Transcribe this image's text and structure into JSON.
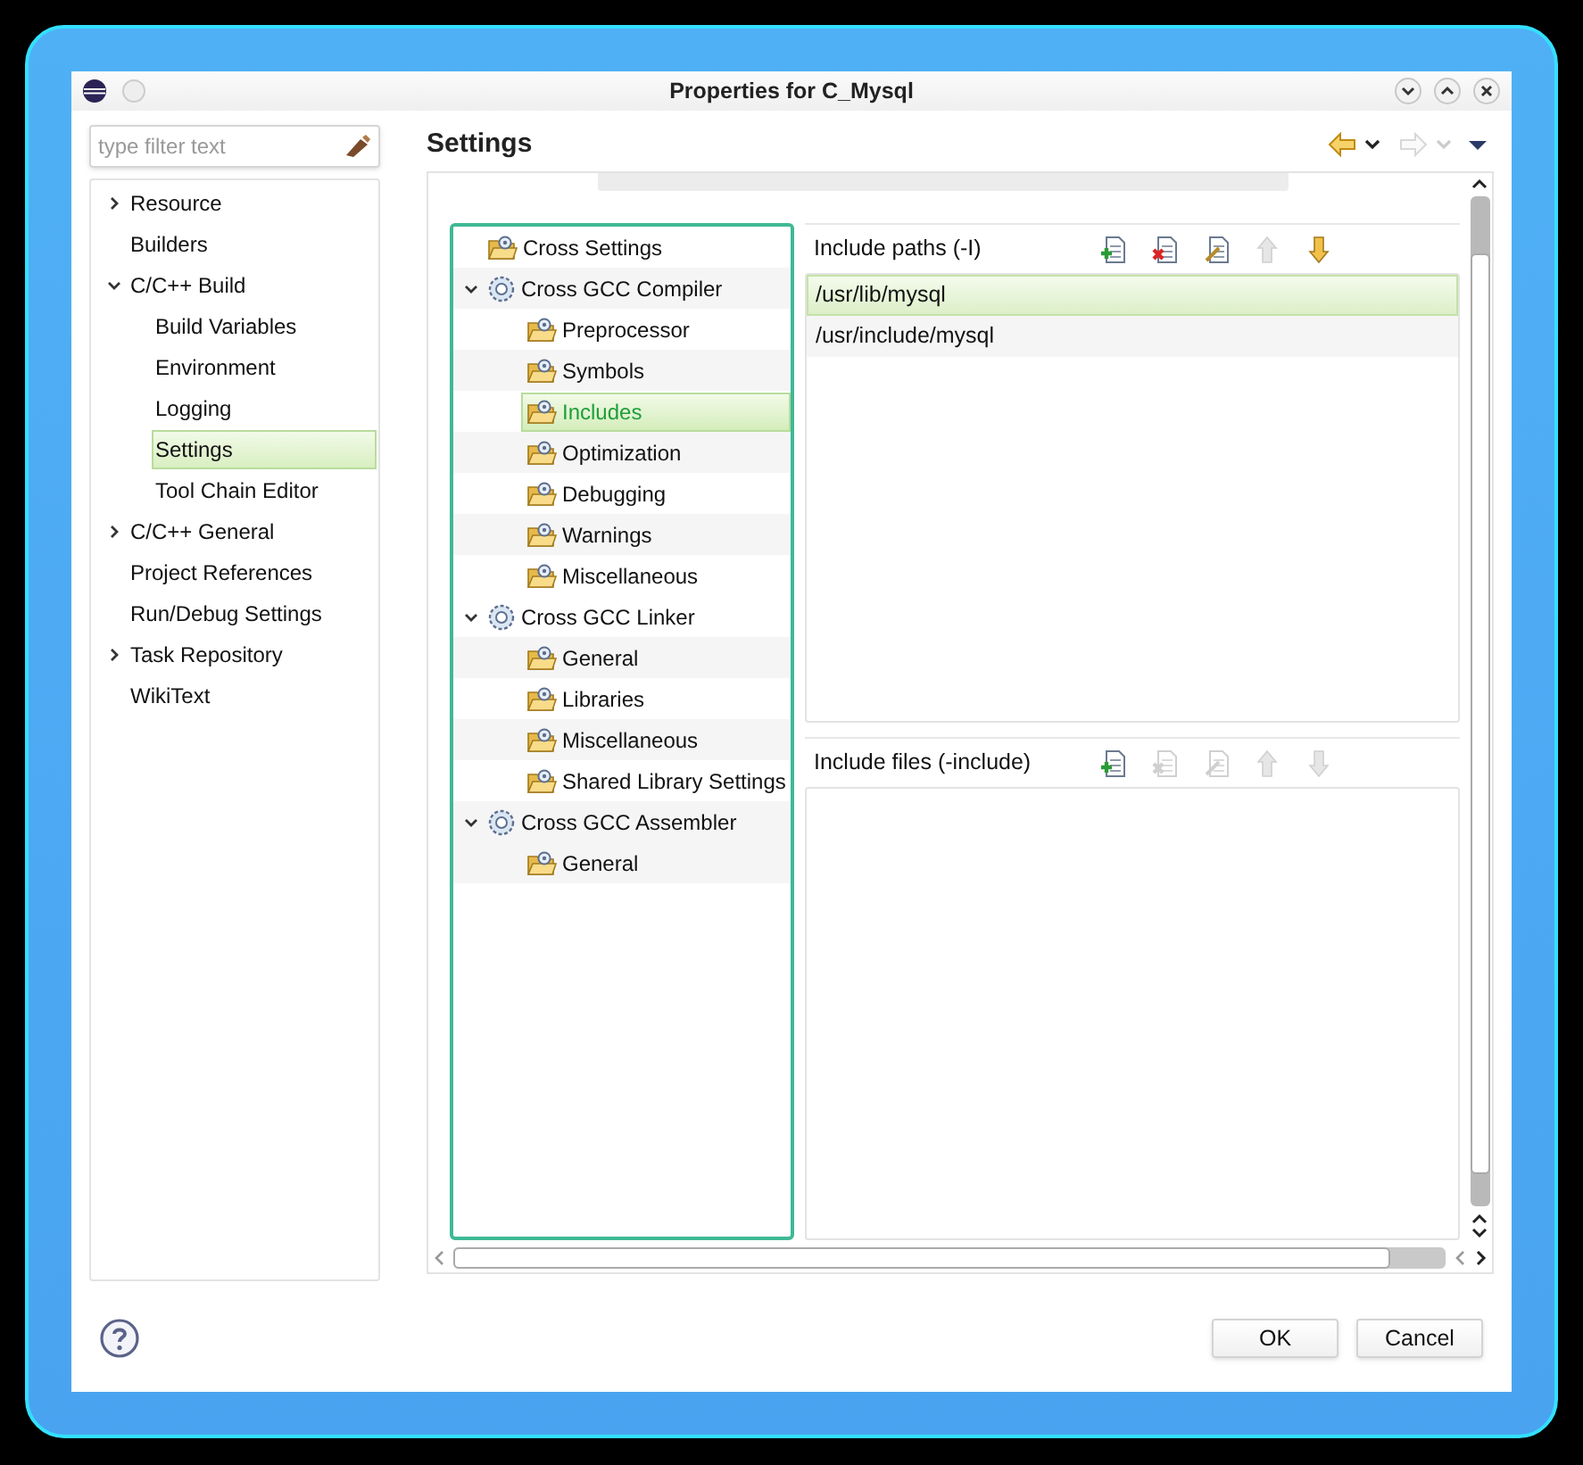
{
  "window": {
    "title": "Properties for C_Mysql"
  },
  "filter": {
    "placeholder": "type filter text"
  },
  "nav": [
    {
      "label": "Resource",
      "expanded": false,
      "selected": false
    },
    {
      "label": "Builders",
      "selected": false
    },
    {
      "label": "C/C++ Build",
      "expanded": true,
      "selected": false,
      "children": [
        {
          "label": "Build Variables",
          "selected": false
        },
        {
          "label": "Environment",
          "selected": false
        },
        {
          "label": "Logging",
          "selected": false
        },
        {
          "label": "Settings",
          "selected": true
        },
        {
          "label": "Tool Chain Editor",
          "selected": false
        }
      ]
    },
    {
      "label": "C/C++ General",
      "expanded": false,
      "selected": false
    },
    {
      "label": "Project References",
      "selected": false
    },
    {
      "label": "Run/Debug Settings",
      "selected": false
    },
    {
      "label": "Task Repository",
      "expanded": false,
      "selected": false
    },
    {
      "label": "WikiText",
      "selected": false
    }
  ],
  "page_title": "Settings",
  "tool_tree": [
    {
      "label": "Cross Settings",
      "kind": "folder",
      "selected": false
    },
    {
      "label": "Cross GCC Compiler",
      "kind": "tool",
      "expanded": true,
      "selected": false,
      "children": [
        {
          "label": "Preprocessor",
          "kind": "folder",
          "selected": false
        },
        {
          "label": "Symbols",
          "kind": "folder",
          "selected": false
        },
        {
          "label": "Includes",
          "kind": "folder",
          "selected": true
        },
        {
          "label": "Optimization",
          "kind": "folder",
          "selected": false
        },
        {
          "label": "Debugging",
          "kind": "folder",
          "selected": false
        },
        {
          "label": "Warnings",
          "kind": "folder",
          "selected": false
        },
        {
          "label": "Miscellaneous",
          "kind": "folder",
          "selected": false
        }
      ]
    },
    {
      "label": "Cross GCC Linker",
      "kind": "tool",
      "expanded": true,
      "selected": false,
      "children": [
        {
          "label": "General",
          "kind": "folder",
          "selected": false
        },
        {
          "label": "Libraries",
          "kind": "folder",
          "selected": false
        },
        {
          "label": "Miscellaneous",
          "kind": "folder",
          "selected": false
        },
        {
          "label": "Shared Library Settings",
          "kind": "folder",
          "selected": false
        }
      ]
    },
    {
      "label": "Cross GCC Assembler",
      "kind": "tool",
      "expanded": true,
      "selected": false,
      "children": [
        {
          "label": "General",
          "kind": "folder",
          "selected": false
        }
      ]
    }
  ],
  "sections": [
    {
      "title": "Include paths (-I)",
      "tools": [
        {
          "kind": "add",
          "disabled": false
        },
        {
          "kind": "delete",
          "disabled": false
        },
        {
          "kind": "edit",
          "disabled": false
        },
        {
          "kind": "up",
          "disabled": true
        },
        {
          "kind": "down",
          "disabled": false
        }
      ],
      "items": [
        {
          "label": "/usr/lib/mysql",
          "selected": true
        },
        {
          "label": "/usr/include/mysql",
          "selected": false
        }
      ]
    },
    {
      "title": "Include files (-include)",
      "tools": [
        {
          "kind": "add",
          "disabled": false
        },
        {
          "kind": "delete",
          "disabled": true
        },
        {
          "kind": "edit",
          "disabled": true
        },
        {
          "kind": "up",
          "disabled": true
        },
        {
          "kind": "down",
          "disabled": true
        }
      ]
    }
  ],
  "buttons": [
    "OK",
    "Cancel"
  ]
}
